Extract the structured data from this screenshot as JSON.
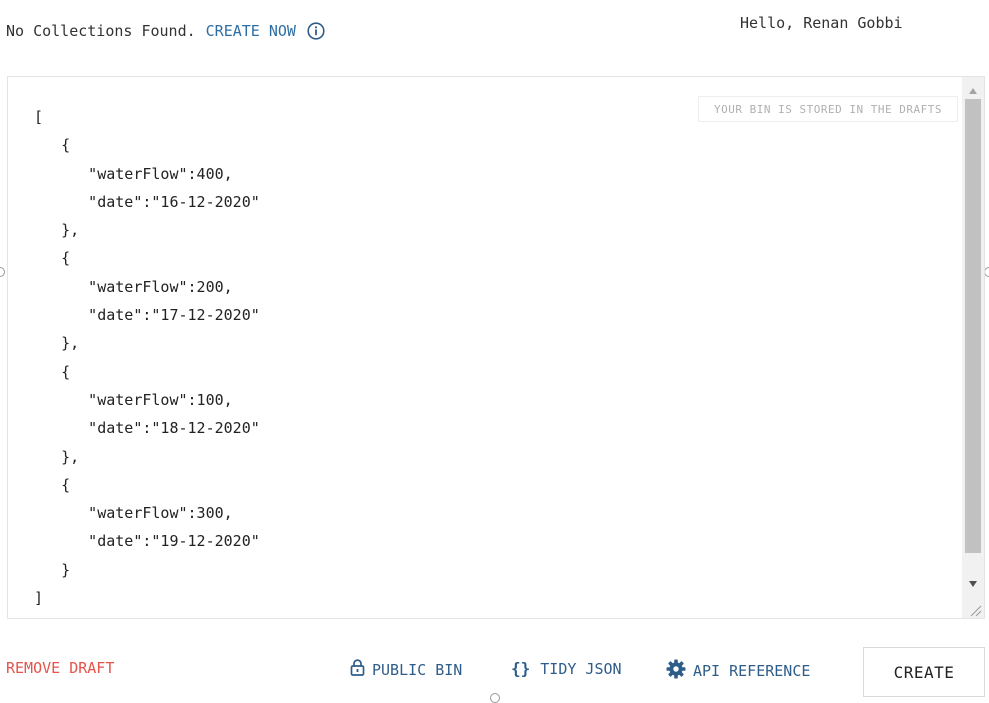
{
  "header": {
    "collections_message": "No Collections Found.",
    "create_now_label": "CREATE NOW",
    "greeting": "Hello, Renan Gobbi"
  },
  "editor": {
    "draft_notice": "YOUR BIN IS STORED IN THE DRAFTS",
    "lines": [
      "[",
      "   {",
      "      \"waterFlow\":400,",
      "      \"date\":\"16-12-2020\"",
      "   },",
      "   {",
      "      \"waterFlow\":200,",
      "      \"date\":\"17-12-2020\"",
      "   },",
      "   {",
      "      \"waterFlow\":100,",
      "      \"date\":\"18-12-2020\"",
      "   },",
      "   {",
      "      \"waterFlow\":300,",
      "      \"date\":\"19-12-2020\"",
      "   }",
      "]"
    ]
  },
  "footer": {
    "remove_draft_label": "REMOVE DRAFT",
    "public_bin_label": "PUBLIC BIN",
    "tidy_json_icon": "{}",
    "tidy_json_label": "TIDY JSON",
    "api_reference_label": "API REFERENCE",
    "create_label": "CREATE"
  },
  "icons": {
    "info": "info-circle-icon",
    "lock": "lock-icon",
    "gear": "gear-icon"
  },
  "colors": {
    "link_blue": "#2f6ea3",
    "action_blue": "#2f5d8a",
    "danger_red": "#e5534b",
    "text": "#333333",
    "muted": "#b0b0b0"
  }
}
